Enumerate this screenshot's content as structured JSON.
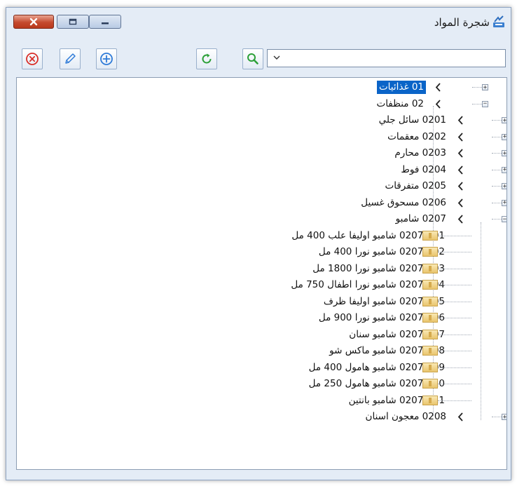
{
  "window": {
    "title": "شجرة المواد"
  },
  "title_buttons": {
    "close_icon": "close-icon",
    "restore_icon": "restore-icon",
    "minimize_icon": "minimize-icon"
  },
  "toolbar": {
    "delete_icon": "delete-circle-icon",
    "edit_icon": "pencil-icon",
    "add_icon": "add-circle-icon",
    "refresh_icon": "refresh-icon",
    "search_icon": "search-icon",
    "search_combo_value": ""
  },
  "colors": {
    "selection": "#0a64c8",
    "window_bg": "#e4ecf6",
    "close_button": "#c54a2e"
  },
  "tree": {
    "nodes": [
      {
        "label": "01 غذائيات",
        "level": 0,
        "state": "collapsed",
        "selected": true
      },
      {
        "label": "02 منظفات",
        "level": 0,
        "state": "expanded"
      },
      {
        "label": "0201 سائل جلي",
        "level": 1,
        "state": "collapsed"
      },
      {
        "label": "0202 معقمات",
        "level": 1,
        "state": "collapsed"
      },
      {
        "label": "0203 محارم",
        "level": 1,
        "state": "collapsed"
      },
      {
        "label": "0204 فوط",
        "level": 1,
        "state": "collapsed"
      },
      {
        "label": "0205 متفرقات",
        "level": 1,
        "state": "collapsed"
      },
      {
        "label": "0206 مسحوق غسيل",
        "level": 1,
        "state": "collapsed"
      },
      {
        "label": "0207 شامبو",
        "level": 1,
        "state": "expanded"
      },
      {
        "label": "0207-001 شامبو اوليفا علب 400 مل",
        "level": 2,
        "state": "leaf"
      },
      {
        "label": "0207-002 شامبو نورا 400 مل",
        "level": 2,
        "state": "leaf"
      },
      {
        "label": "0207-003 شامبو نورا 1800 مل",
        "level": 2,
        "state": "leaf"
      },
      {
        "label": "0207-004 شامبو نورا اطفال 750 مل",
        "level": 2,
        "state": "leaf"
      },
      {
        "label": "0207-005 شامبو اوليفا ظرف",
        "level": 2,
        "state": "leaf"
      },
      {
        "label": "0207-006 شامبو نورا 900 مل",
        "level": 2,
        "state": "leaf"
      },
      {
        "label": "0207-007 شامبو سنان",
        "level": 2,
        "state": "leaf"
      },
      {
        "label": "0207-008 شامبو ماكس شو",
        "level": 2,
        "state": "leaf"
      },
      {
        "label": "0207-009 شامبو هامول 400 مل",
        "level": 2,
        "state": "leaf"
      },
      {
        "label": "0207-010 شامبو هامول 250 مل",
        "level": 2,
        "state": "leaf"
      },
      {
        "label": "0207-011 شامبو بانتين",
        "level": 2,
        "state": "leaf"
      },
      {
        "label": "0208 معجون اسنان",
        "level": 1,
        "state": "collapsed"
      }
    ]
  }
}
